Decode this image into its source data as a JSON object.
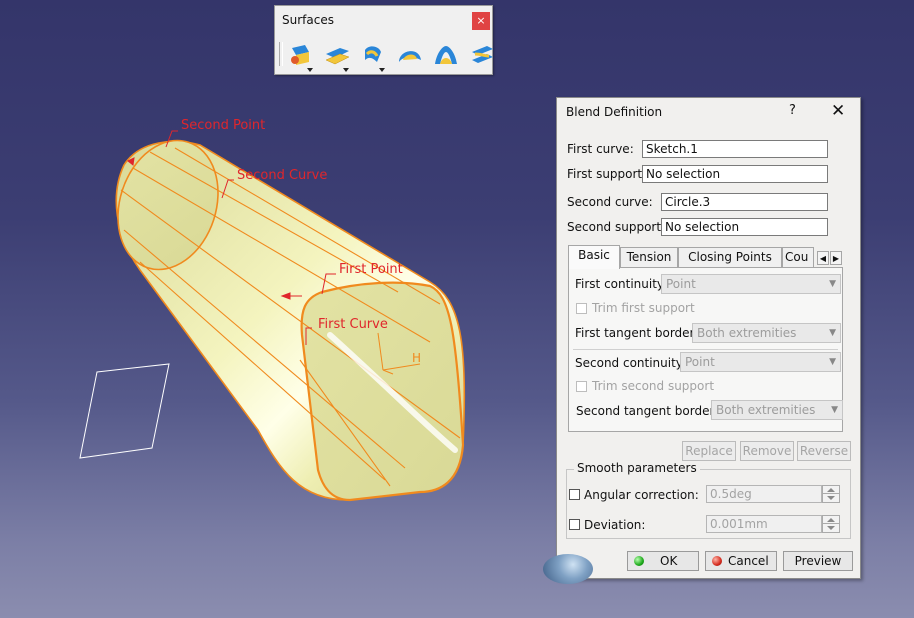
{
  "viewport": {
    "annotations": {
      "second_point": "Second Point",
      "second_curve": "Second Curve",
      "first_point": "First Point",
      "first_curve": "First Curve",
      "axis_h": "H"
    },
    "colors": {
      "surface": "#eeeeb0",
      "edges": "#f08a1e",
      "annotation": "#e0262c"
    }
  },
  "toolbar": {
    "title": "Surfaces",
    "close": "×",
    "buttons": [
      {
        "name": "extrude-icon"
      },
      {
        "name": "offset-icon"
      },
      {
        "name": "sweep-icon"
      },
      {
        "name": "fill-icon"
      },
      {
        "name": "multi-section-surface-icon"
      },
      {
        "name": "blend-icon"
      }
    ]
  },
  "dialog": {
    "title": "Blend Definition",
    "help": "?",
    "close": "✕",
    "first_curve_label": "First curve:",
    "first_curve_value": "Sketch.1",
    "first_support_label": "First support:",
    "first_support_value": "No selection",
    "second_curve_label": "Second curve:",
    "second_curve_value": "Circle.3",
    "second_support_label": "Second support:",
    "second_support_value": "No selection",
    "tabs": [
      "Basic",
      "Tension",
      "Closing Points",
      "Cou"
    ],
    "basic": {
      "first_continuity_label": "First continuity:",
      "first_continuity_value": "Point",
      "trim_first_label": "Trim first support",
      "first_tangent_label": "First tangent borders:",
      "first_tangent_value": "Both extremities",
      "second_continuity_label": "Second continuity:",
      "second_continuity_value": "Point",
      "trim_second_label": "Trim second support",
      "second_tangent_label": "Second tangent borders:",
      "second_tangent_value": "Both extremities"
    },
    "replace_label": "Replace",
    "remove_label": "Remove",
    "reverse_label": "Reverse",
    "smooth_title": "Smooth parameters",
    "angular_label": "Angular correction:",
    "angular_value": "0.5deg",
    "deviation_label": "Deviation:",
    "deviation_value": "0.001mm",
    "ok_label": "OK",
    "cancel_label": "Cancel",
    "preview_label": "Preview"
  }
}
